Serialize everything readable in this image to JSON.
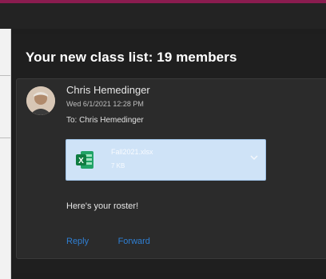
{
  "dialog": {
    "title": "Your new class list: 19 members"
  },
  "message": {
    "sender": "Chris Hemedinger",
    "date": "Wed 6/1/2021 12:28 PM",
    "to_line": "To: Chris Hemedinger",
    "attachment": {
      "name": "Fall2021.xlsx",
      "size": "7 KB",
      "icon": "excel-icon"
    },
    "body": "Here's your roster!",
    "actions": {
      "reply": "Reply",
      "forward": "Forward"
    }
  },
  "colors": {
    "background": "#1e1e1e",
    "card": "#2b2b2b",
    "attachment_bg": "#cfe3f7",
    "link": "#2f7fd3",
    "accent_bar": "#8a1c4f"
  }
}
